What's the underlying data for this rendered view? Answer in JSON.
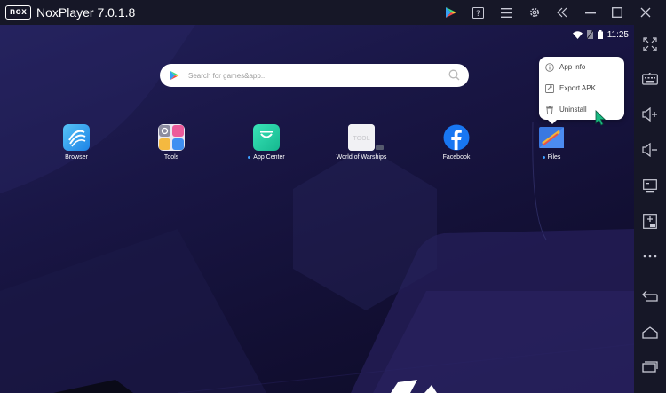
{
  "titlebar": {
    "logo": "nox",
    "title": "NoxPlayer 7.0.1.8",
    "icons": [
      "play-store-icon",
      "help-icon",
      "menu-icon",
      "settings-icon",
      "minimize-icon",
      "maximize-icon",
      "close-icon"
    ]
  },
  "statusbar": {
    "time": "11:25"
  },
  "search": {
    "placeholder": "Search for games&app..."
  },
  "apps": [
    {
      "label": "Browser",
      "dot": false
    },
    {
      "label": "Tools",
      "dot": false
    },
    {
      "label": "App Center",
      "dot": true
    },
    {
      "label": "World of Warships",
      "dot": false
    },
    {
      "label": "Facebook",
      "dot": false
    },
    {
      "label": "Files",
      "dot": true
    }
  ],
  "popup": {
    "items": [
      {
        "label": "App info"
      },
      {
        "label": "Export APK"
      },
      {
        "label": "Uninstall"
      }
    ]
  },
  "warships_badge": "TOOL",
  "sidebar": {
    "icons": [
      "fullscreen-icon",
      "keyboard-icon",
      "volume-up-icon",
      "volume-down-icon",
      "screen-icon",
      "add-apk-icon",
      "more-icon",
      "back-icon",
      "home-icon",
      "recents-icon"
    ]
  },
  "colors": {
    "accent": "#3da0ff",
    "titlebar": "#161727",
    "cursor": "#19b981"
  }
}
